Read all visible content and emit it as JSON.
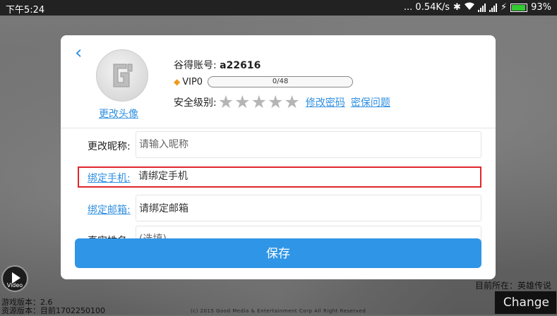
{
  "status_bar": {
    "time": "下午5:24",
    "network_speed": "... 0.54K/s",
    "battery_percent": "93%",
    "battery_level": 0.93,
    "icons": [
      "bluetooth-icon",
      "wifi-icon",
      "signal-icon",
      "signal-icon",
      "charging-icon",
      "battery-icon"
    ]
  },
  "dialog": {
    "back_icon": "chevron-left-icon",
    "avatar": {
      "change_label": "更改头像"
    },
    "account": {
      "label": "谷得账号:",
      "value": "a22616"
    },
    "vip": {
      "label": "VIP0",
      "progress_text": "0/48",
      "progress": 0
    },
    "security": {
      "label": "安全级别:",
      "stars_total": 5,
      "stars_filled": 0,
      "change_password": "修改密码",
      "security_question": "密保问题"
    },
    "form": {
      "nickname": {
        "label": "更改昵称:",
        "placeholder": "请输入昵称"
      },
      "phone": {
        "label": "绑定手机:",
        "value": "请绑定手机"
      },
      "email": {
        "label": "绑定邮箱:",
        "value": "请绑定邮箱"
      },
      "realname": {
        "label": "真实姓名:",
        "placeholder": "(选填)"
      }
    },
    "save_button": "保存"
  },
  "game": {
    "video_label": "Video",
    "game_version": "游戏版本：2.6",
    "resource_version": "资源版本：目前1702250100",
    "location": "目前所在：英雄传说",
    "copyright": "(c) 2015 Good Media & Entertainment Corp All Right Reserved",
    "change_button": "Change"
  },
  "colors": {
    "accent": "#2f95e6",
    "highlight": "#e0262b",
    "battery": "#33cc33"
  }
}
